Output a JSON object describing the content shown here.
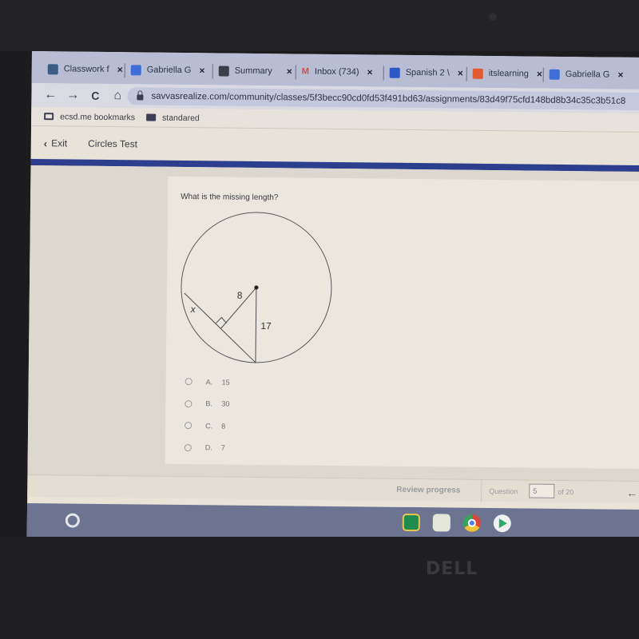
{
  "browser": {
    "tabs": [
      {
        "label": "Classwork f",
        "icon": "google-classroom-icon"
      },
      {
        "label": "Gabriella G",
        "icon": "google-docs-icon"
      },
      {
        "label": "Summary",
        "icon": "summary-app-icon"
      },
      {
        "label": "Inbox (734)",
        "icon": "gmail-icon"
      },
      {
        "label": "Spanish 2 \\",
        "icon": "spanish-course-icon"
      },
      {
        "label": "itslearning",
        "icon": "itslearning-icon"
      },
      {
        "label": "Gabriella G",
        "icon": "google-docs-icon"
      }
    ],
    "tab_close_glyph": "×",
    "url": "savvasrealize.com/community/classes/5f3becc90cd0fd53f491bd63/assignments/83d49f75cfd148bd8b34c35c3b51c8",
    "nav": {
      "back": "←",
      "forward": "→",
      "reload": "C",
      "home": "⌂"
    },
    "bookmarks": [
      {
        "label": "ecsd.me bookmarks",
        "icon": "bookmark-folder-icon"
      },
      {
        "label": "standared",
        "icon": "folder-icon"
      }
    ]
  },
  "app": {
    "exit_label": "Exit",
    "exit_glyph": "‹",
    "test_title": "Circles Test",
    "question": {
      "prompt": "What is the missing length?",
      "diagram": {
        "segment_label_perpendicular": "8",
        "segment_label_radius": "17",
        "unknown_label": "x"
      },
      "options": [
        {
          "letter": "A.",
          "value": "15"
        },
        {
          "letter": "B.",
          "value": "30"
        },
        {
          "letter": "C.",
          "value": "8"
        },
        {
          "letter": "D.",
          "value": "7"
        }
      ]
    },
    "footer": {
      "review_label": "Review progress",
      "question_label": "Question",
      "current_question": "5",
      "total_label": "of 20",
      "prev_glyph": "←"
    }
  },
  "shelf": {
    "apps": [
      "google-classroom",
      "google-meet",
      "chrome",
      "play-store"
    ]
  },
  "device": {
    "brand": "DELL"
  }
}
